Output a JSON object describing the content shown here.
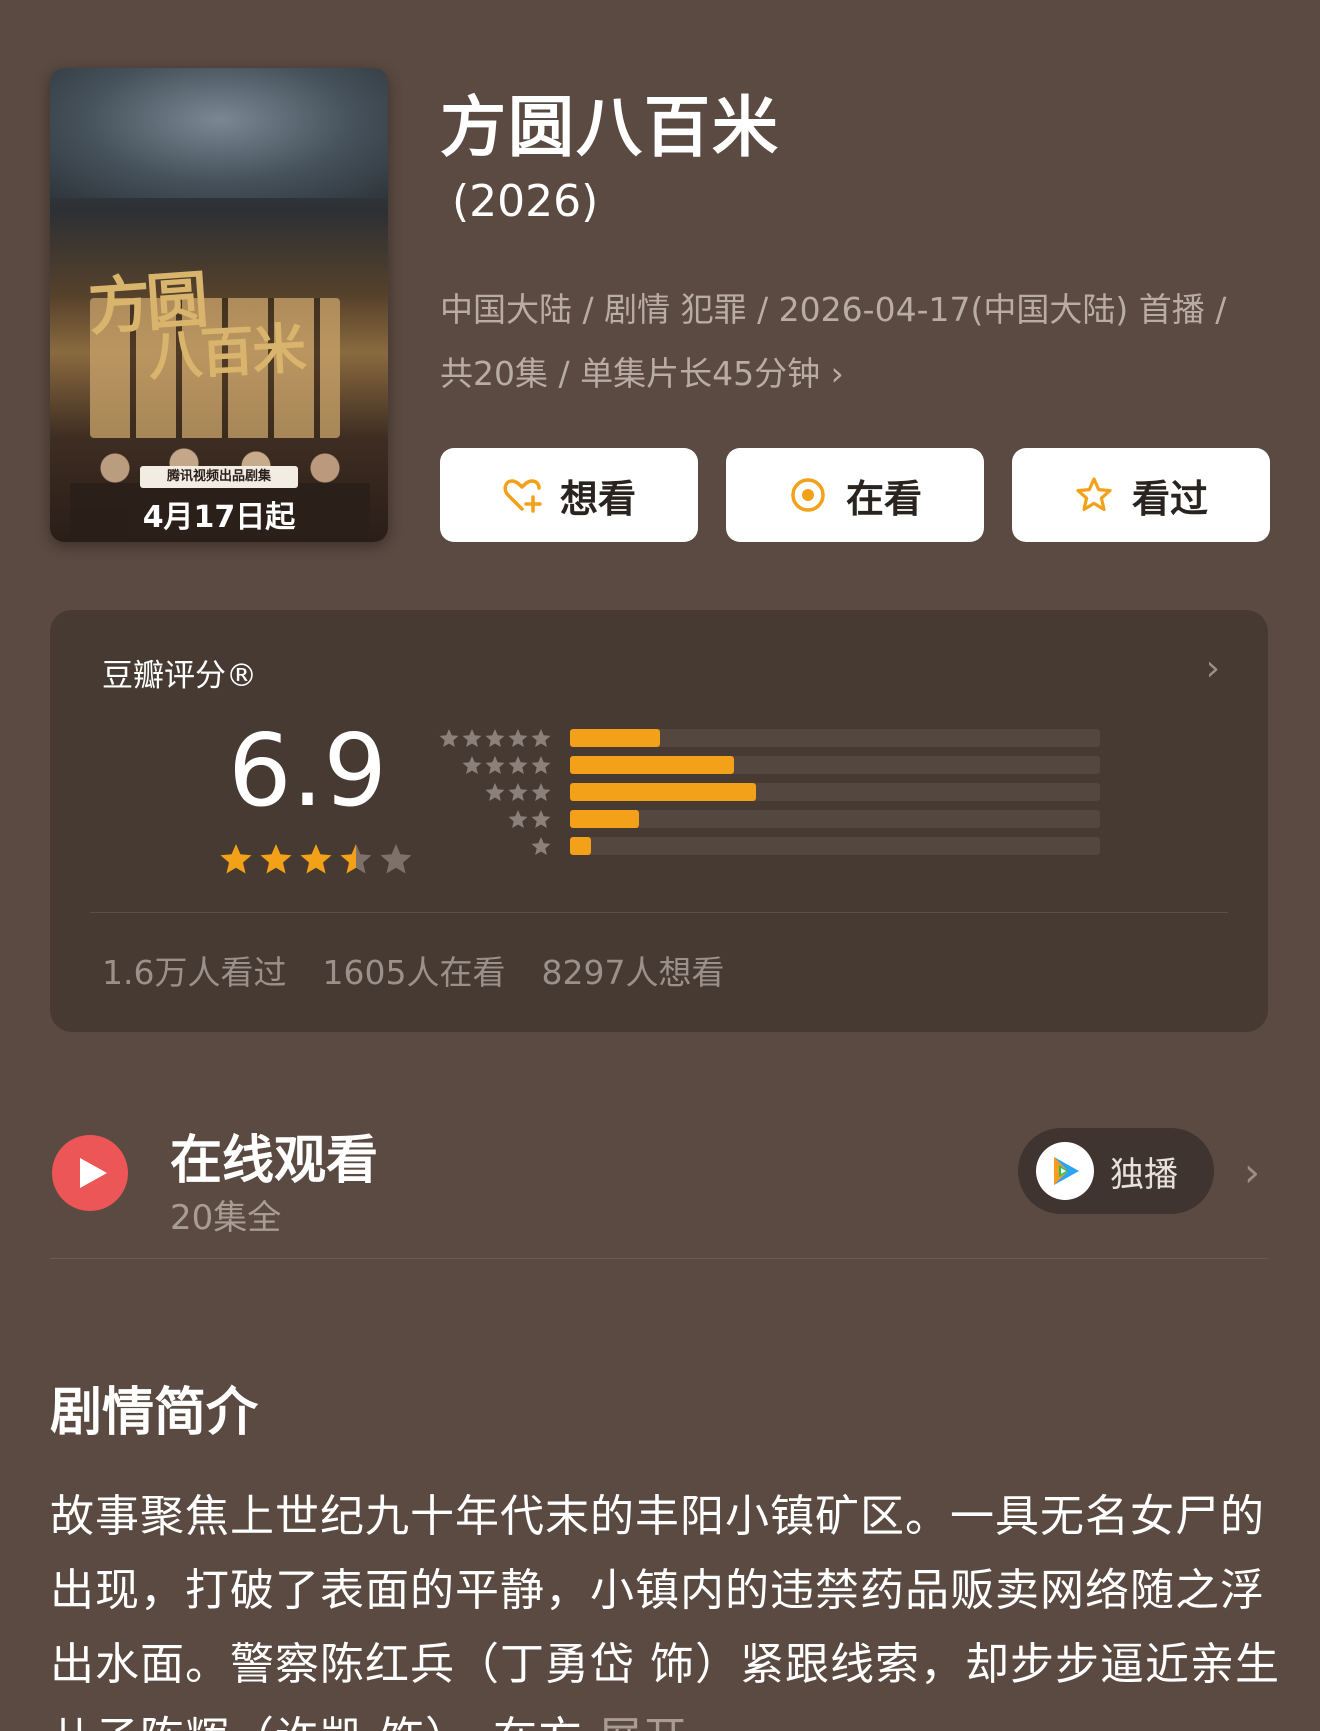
{
  "poster": {
    "title_line1": "方圆",
    "title_line2": "八百米",
    "badge": "腾讯视频出品剧集",
    "date": "4月17日起"
  },
  "title": "方圆八百米",
  "year": "(2026)",
  "meta": "中国大陆 / 剧情 犯罪 / 2026-04-17(中国大陆) 首播 / 共20集 / 单集片长45分钟",
  "actions": [
    {
      "label": "想看",
      "icon": "heart-plus-icon"
    },
    {
      "label": "在看",
      "icon": "target-icon"
    },
    {
      "label": "看过",
      "icon": "star-outline-icon"
    }
  ],
  "rating": {
    "label": "豆瓣评分®",
    "score": "6.9",
    "stars": 3.5,
    "distribution": [
      {
        "stars": 5,
        "fraction": 0.17
      },
      {
        "stars": 4,
        "fraction": 0.31
      },
      {
        "stars": 3,
        "fraction": 0.35
      },
      {
        "stars": 2,
        "fraction": 0.13
      },
      {
        "stars": 1,
        "fraction": 0.04
      }
    ],
    "counts": [
      "1.6万人看过",
      "1605人在看",
      "8297人想看"
    ]
  },
  "online": {
    "title": "在线观看",
    "subtitle": "20集全",
    "platform_label": "独播",
    "platform_icon": "tencent-video-icon"
  },
  "synopsis": {
    "title": "剧情简介",
    "text": "故事聚焦上世纪九十年代末的丰阳小镇矿区。一具无名女尸的出现，打破了表面的平静，小镇内的违禁药品贩卖网络随之浮出水面。警察陈红兵（丁勇岱 饰）紧跟线索，却步步逼近亲生儿子陈辉（许凯 饰）。在方",
    "more": "展开"
  },
  "colors": {
    "background": "#5a4a41",
    "card": "#463a33",
    "accent": "#f2a118",
    "play_red": "#ec5656"
  }
}
